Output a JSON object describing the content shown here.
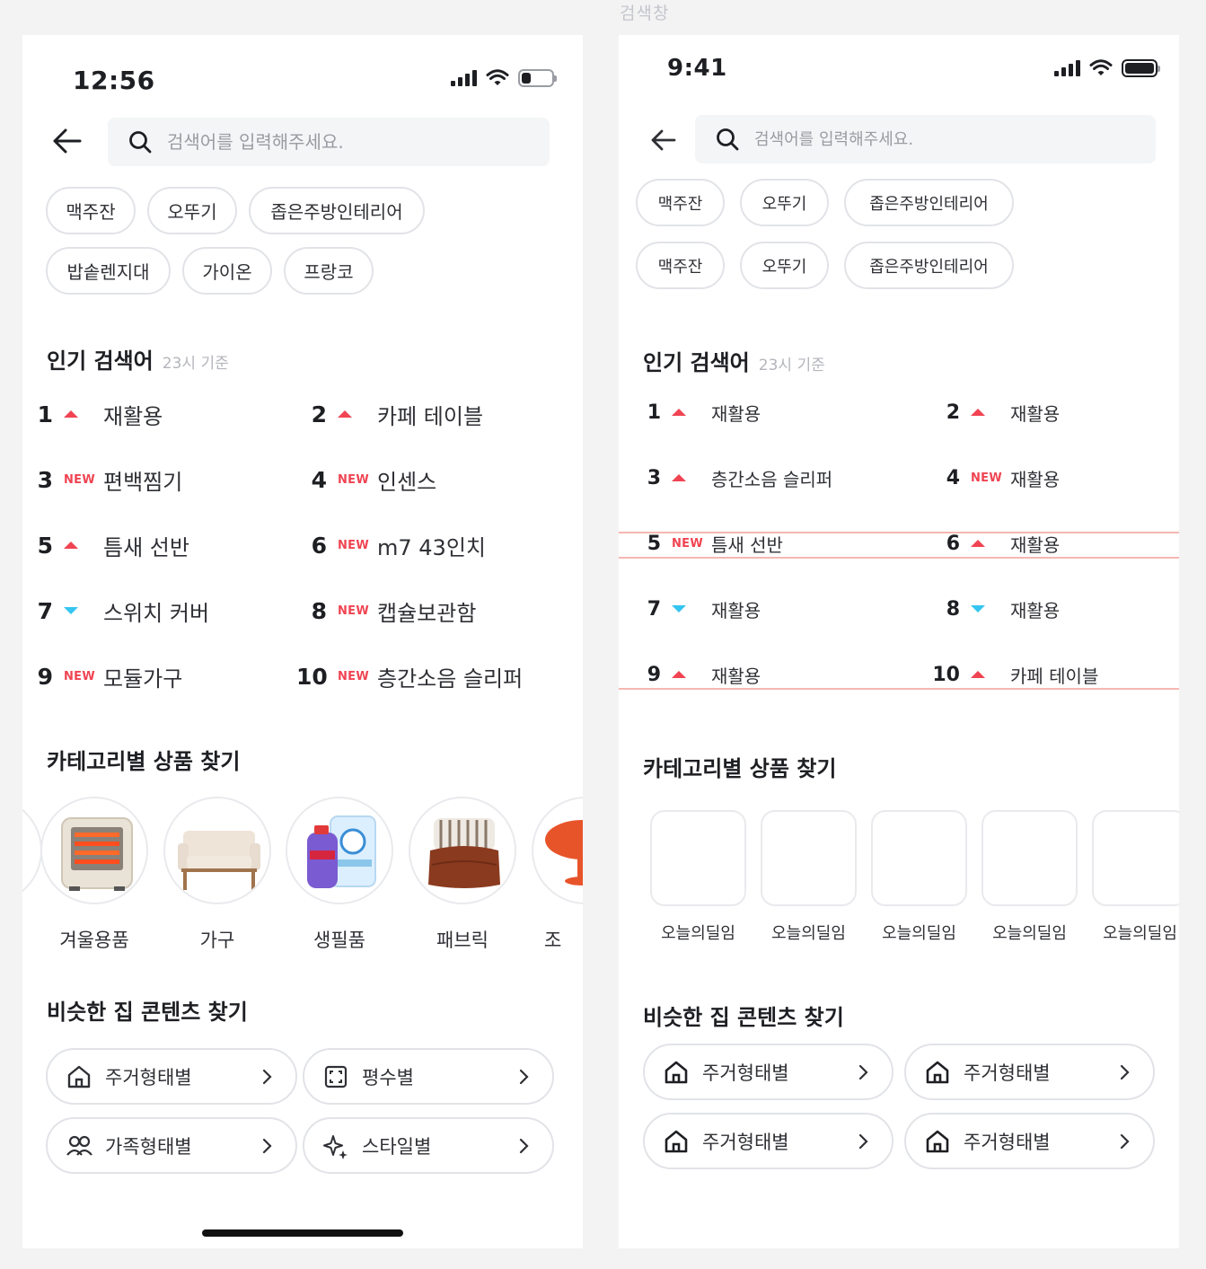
{
  "canvas_label": "검색창",
  "left": {
    "status_time": "12:56",
    "search_placeholder": "검색어를 입력해주세요.",
    "chips": [
      "맥주잔",
      "오뚜기",
      "좁은주방인테리어",
      "밥솥렌지대",
      "가이온",
      "프랑코"
    ],
    "popular_title": "인기 검색어",
    "popular_sub": "23시 기준",
    "ranks": [
      {
        "num": "1",
        "mark": "up",
        "label": "재활용"
      },
      {
        "num": "2",
        "mark": "up",
        "label": "카페 테이블"
      },
      {
        "num": "3",
        "mark": "new",
        "label": "편백찜기"
      },
      {
        "num": "4",
        "mark": "new",
        "label": "인센스"
      },
      {
        "num": "5",
        "mark": "up",
        "label": "틈새 선반"
      },
      {
        "num": "6",
        "mark": "new",
        "label": "m7 43인치"
      },
      {
        "num": "7",
        "mark": "down",
        "label": "스위치 커버"
      },
      {
        "num": "8",
        "mark": "new",
        "label": "캡슐보관함"
      },
      {
        "num": "9",
        "mark": "new",
        "label": "모듈가구"
      },
      {
        "num": "10",
        "mark": "new",
        "label": "층간소음 슬리퍼"
      }
    ],
    "new_text": "NEW",
    "category_title": "카테고리별 상품 찾기",
    "categories": [
      "겨울용품",
      "가구",
      "생필품",
      "패브릭",
      "조"
    ],
    "similar_title": "비슷한 집 콘텐츠 찾기",
    "similar": [
      {
        "icon": "house-icon",
        "label": "주거형태별"
      },
      {
        "icon": "expand-area-icon",
        "label": "평수별"
      },
      {
        "icon": "people-icon",
        "label": "가족형태별"
      },
      {
        "icon": "sparkle-icon",
        "label": "스타일별"
      }
    ]
  },
  "right": {
    "status_time": "9:41",
    "search_placeholder": "검색어를 입력해주세요.",
    "chips": [
      "맥주잔",
      "오뚜기",
      "좁은주방인테리어",
      "맥주잔",
      "오뚜기",
      "좁은주방인테리어"
    ],
    "popular_title": "인기 검색어",
    "popular_sub": "23시 기준",
    "ranks": [
      {
        "num": "1",
        "mark": "up",
        "label": "재활용"
      },
      {
        "num": "2",
        "mark": "up",
        "label": "재활용"
      },
      {
        "num": "3",
        "mark": "up",
        "label": "층간소음 슬리퍼"
      },
      {
        "num": "4",
        "mark": "new",
        "label": "재활용"
      },
      {
        "num": "5",
        "mark": "new",
        "label": "틈새 선반"
      },
      {
        "num": "6",
        "mark": "up",
        "label": "재활용"
      },
      {
        "num": "7",
        "mark": "down",
        "label": "재활용"
      },
      {
        "num": "8",
        "mark": "down",
        "label": "재활용"
      },
      {
        "num": "9",
        "mark": "up",
        "label": "재활용"
      },
      {
        "num": "10",
        "mark": "up",
        "label": "카페 테이블"
      }
    ],
    "new_text": "NEW",
    "category_title": "카테고리별 상품 찾기",
    "tiles": [
      "오늘의딜임",
      "오늘의딜임",
      "오늘의딜임",
      "오늘의딜임",
      "오늘의딜임"
    ],
    "similar_title": "비슷한 집 콘텐츠 찾기",
    "similar": [
      {
        "icon": "house-icon",
        "label": "주거형태별"
      },
      {
        "icon": "house-icon",
        "label": "주거형태별"
      },
      {
        "icon": "house-icon",
        "label": "주거형태별"
      },
      {
        "icon": "house-icon",
        "label": "주거형태별"
      }
    ]
  },
  "colors": {
    "up": "#f04452",
    "down": "#35c5f0",
    "new": "#f04452",
    "guide": "#f5b7b1"
  }
}
